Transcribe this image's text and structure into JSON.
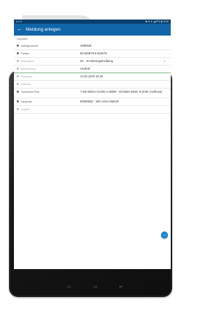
{
  "colors": {
    "accent": "#1166aa",
    "statusbar": "#0b3f6b",
    "fab": "#1a86d6",
    "arrow": "#e4e4e4"
  },
  "statusbar": {
    "left": "● ▸ ⊙",
    "right": "✱ ⊕ ▼ ◢ 87% ▮ 15:46"
  },
  "appbar": {
    "back_icon": "←",
    "title": "Meldung anlegen"
  },
  "section": {
    "title": "Kopfdaten"
  },
  "fields": [
    {
      "label": "Auftragsnummer",
      "value": "4090525",
      "icon": "hash-icon"
    },
    {
      "label": "Position",
      "value": "50.520579 6.916075",
      "icon": "location-pin-icon"
    },
    {
      "label": "Meldungsart",
      "value": "Z2 - IH-Störungsmeldung",
      "icon": "tag-icon",
      "dropdown": "▾"
    },
    {
      "label": "Beschreibung",
      "value": "Undicht",
      "icon": "edit-icon"
    },
    {
      "label": "Störbeginn",
      "value": "14.02.2019 15:18",
      "icon": "calendar-icon"
    },
    {
      "label": "Störende",
      "value": "",
      "icon": "calendar-icon"
    },
    {
      "label": "Technischer Platz",
      "value": "Y-G5-NDGA-VL001-A-B008 - Schieber Bestr. 8 (Köln Confluxa)",
      "icon": "location-pin-icon"
    },
    {
      "label": "Equipment",
      "value": "50000632 - SID-Arma SM100",
      "icon": "gear-icon"
    },
    {
      "label": "Langtext",
      "value": "",
      "icon": "text-icon"
    }
  ],
  "fab": {
    "icon": "→"
  },
  "navbar": {
    "back": "▭",
    "home": "▭",
    "recent": "↩"
  }
}
